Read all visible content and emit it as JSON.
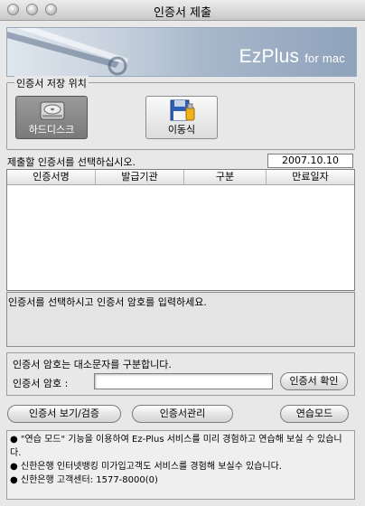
{
  "window": {
    "title": "인증서 제출"
  },
  "banner": {
    "brand": "EzPlus",
    "brand_suffix": "for mac"
  },
  "storage": {
    "legend": "인증서 저장 위치",
    "harddisk_label": "하드디스크",
    "removable_label": "이동식"
  },
  "select_prompt": "제출할 인증서를 선택하십시오.",
  "date": "2007.10.10",
  "table": {
    "headers": [
      "인증서명",
      "발급기관",
      "구분",
      "만료일자"
    ]
  },
  "info_message": "인증서를 선택하시고 인증서 암호를 입력하세요.",
  "password": {
    "case_note": "인증서 암호는 대소문자를 구분합니다.",
    "label": "인증서 암호 :",
    "value": "",
    "confirm_button": "인증서 확인"
  },
  "buttons": {
    "view_verify": "인증서 보기/검증",
    "manage": "인증서관리",
    "practice": "연습모드"
  },
  "notes": [
    "\"연습 모드\" 기능을 이용하여 Ez-Plus 서비스를 미리 경험하고 연습해 보실 수 있습니다.",
    "신한은행 인터넷뱅킹 미가입고객도 서비스를 경험해 보실수 있습니다.",
    "신한은행 고객센터: 1577-8000(0)"
  ],
  "colors": {
    "banner_accent": "#8ea2bb",
    "selected_button": "#7a7a7a"
  }
}
